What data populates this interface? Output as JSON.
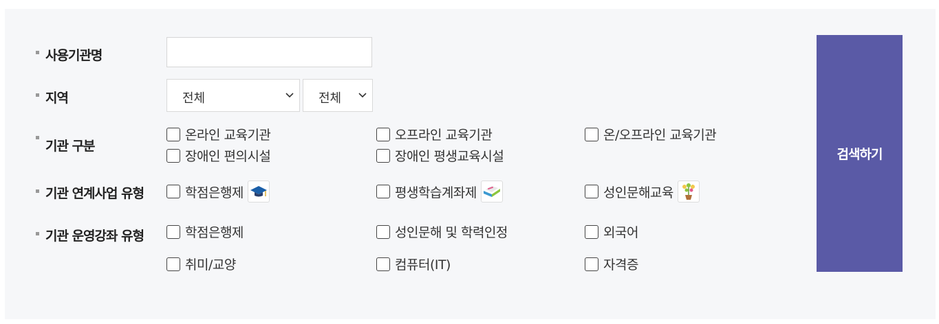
{
  "labels": {
    "org_name": "사용기관명",
    "region": "지역",
    "org_type": "기관 구분",
    "linked_program": "기관 연계사업 유형",
    "course_type": "기관 운영강좌 유형"
  },
  "org_name_input": {
    "value": "",
    "placeholder": ""
  },
  "region": {
    "select1": "전체",
    "select2": "전체"
  },
  "org_type_options": [
    "온라인 교육기관",
    "오프라인 교육기관",
    "온/오프라인 교육기관",
    "장애인 편의시설",
    "장애인 평생교육시설"
  ],
  "linked_program_options": [
    {
      "label": "학점은행제",
      "icon": "graduation-cap-icon"
    },
    {
      "label": "평생학습계좌제",
      "icon": "open-book-icon"
    },
    {
      "label": "성인문해교육",
      "icon": "flower-pot-icon"
    }
  ],
  "course_type_options": [
    "학점은행제",
    "성인문해 및 학력인정",
    "외국어",
    "취미/교양",
    "컴퓨터(IT)",
    "자격증"
  ],
  "search_button": "검색하기",
  "colors": {
    "panel_bg": "#f6f7f9",
    "button_bg": "#5a5aa6"
  }
}
